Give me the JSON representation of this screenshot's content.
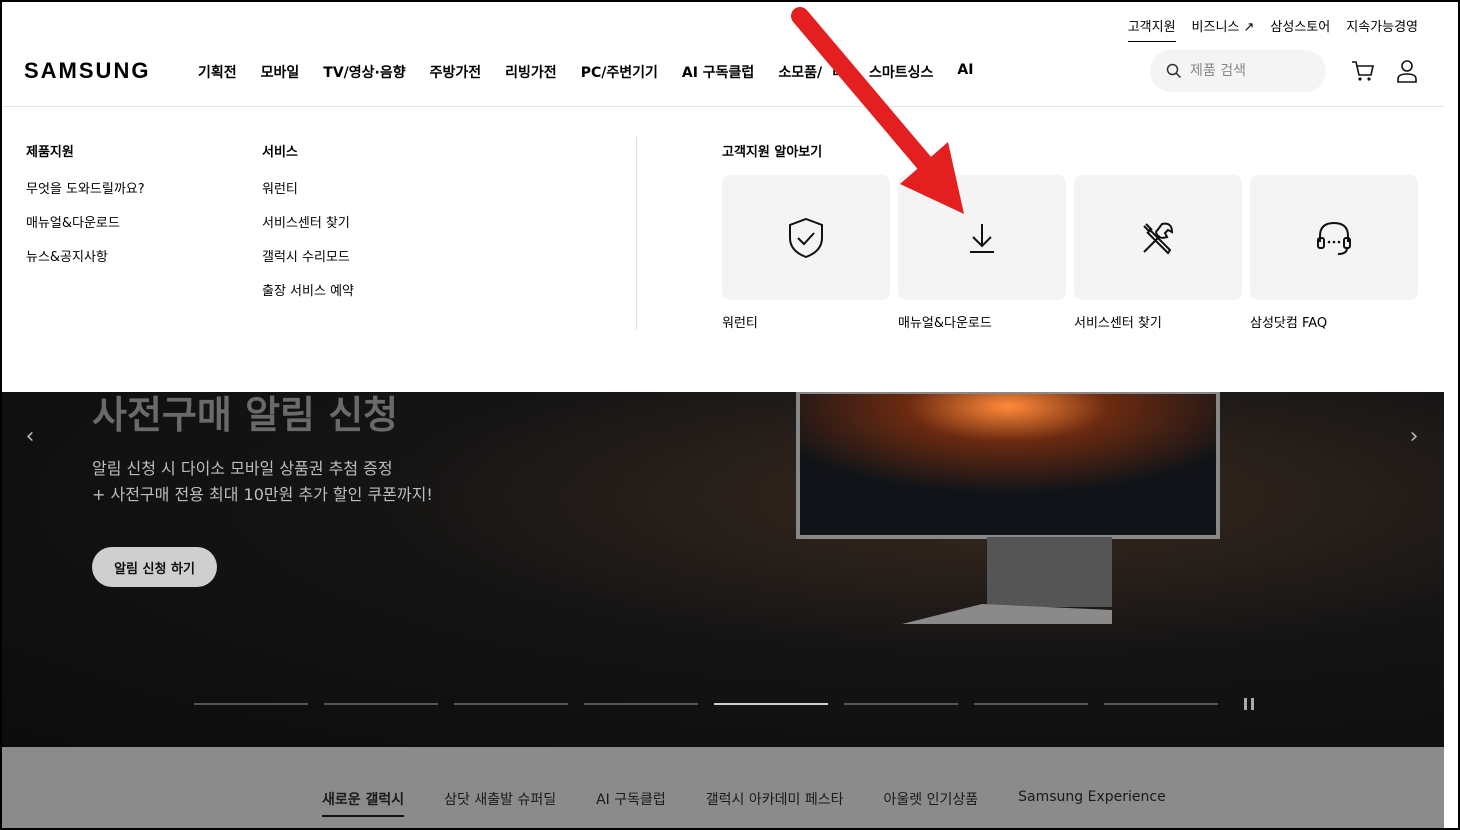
{
  "header": {
    "logo": "SAMSUNG",
    "util_nav": [
      "고객지원",
      "비즈니스 ↗",
      "삼성스토어",
      "지속가능경영"
    ],
    "gnb": [
      "기획전",
      "모바일",
      "TV/영상·음향",
      "주방가전",
      "리빙가전",
      "PC/주변기기",
      "AI 구독클럽",
      "소모품/",
      "리",
      "스마트싱스",
      "AI"
    ],
    "search_placeholder": "제품 검색",
    "icons": [
      "search-icon",
      "cart-icon",
      "user-icon"
    ]
  },
  "mega_menu": {
    "col1": {
      "title": "제품지원",
      "items": [
        "무엇을 도와드릴까요?",
        "매뉴얼&다운로드",
        "뉴스&공지사항"
      ]
    },
    "col2": {
      "title": "서비스",
      "items": [
        "워런티",
        "서비스센터 찾기",
        "갤럭시 수리모드",
        "출장 서비스 예약"
      ]
    },
    "cards_title": "고객지원 알아보기",
    "cards": [
      {
        "label": "워런티",
        "icon": "shield-check-icon"
      },
      {
        "label": "매뉴얼&다운로드",
        "icon": "download-icon"
      },
      {
        "label": "서비스센터 찾기",
        "icon": "tools-icon"
      },
      {
        "label": "삼성닷컴 FAQ",
        "icon": "headset-icon"
      }
    ]
  },
  "hero": {
    "title": "사전구매 알림 신청",
    "sub_line1": "알림 신청 시 다이소 모바일 상품권 추첨 증정",
    "sub_line2": "+ 사전구매 전용 최대 10만원 추가 할인 쿠폰까지!",
    "button": "알림 신청 하기",
    "prev": "‹",
    "next": "›",
    "slides": 8,
    "active_slide": 5
  },
  "tabs": {
    "items": [
      "새로운 갤럭시",
      "삼닷 새출발 슈퍼딜",
      "AI 구독클럽",
      "갤럭시 아카데미 페스타",
      "아울렛 인기상품",
      "Samsung Experience"
    ],
    "active": 0
  },
  "colors": {
    "annotation": "#e41f1f",
    "hero_bg": "#0c0c0c",
    "card_bg": "#f4f4f4"
  }
}
